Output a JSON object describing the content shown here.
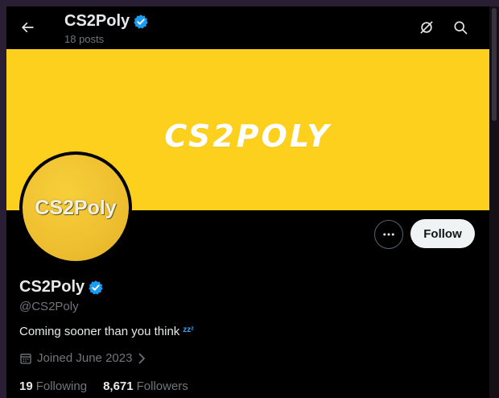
{
  "header": {
    "name": "CS2Poly",
    "posts": "18 posts"
  },
  "banner": {
    "logo_text": "CS2POLY",
    "color": "#fcd01c"
  },
  "avatar": {
    "text": "CS2Poly"
  },
  "actions": {
    "follow_label": "Follow",
    "more_icon": "more-dots-icon"
  },
  "profile": {
    "name": "CS2Poly",
    "handle": "@CS2Poly",
    "bio": "Coming sooner than you think",
    "bio_emoji": "zzᶻ",
    "joined": "Joined June 2023",
    "following_count": "19",
    "following_label": "Following",
    "followers_count": "8,671",
    "followers_label": "Followers"
  },
  "colors": {
    "verified": "#1d9bf0",
    "background": "#000000",
    "muted": "#71767b"
  }
}
